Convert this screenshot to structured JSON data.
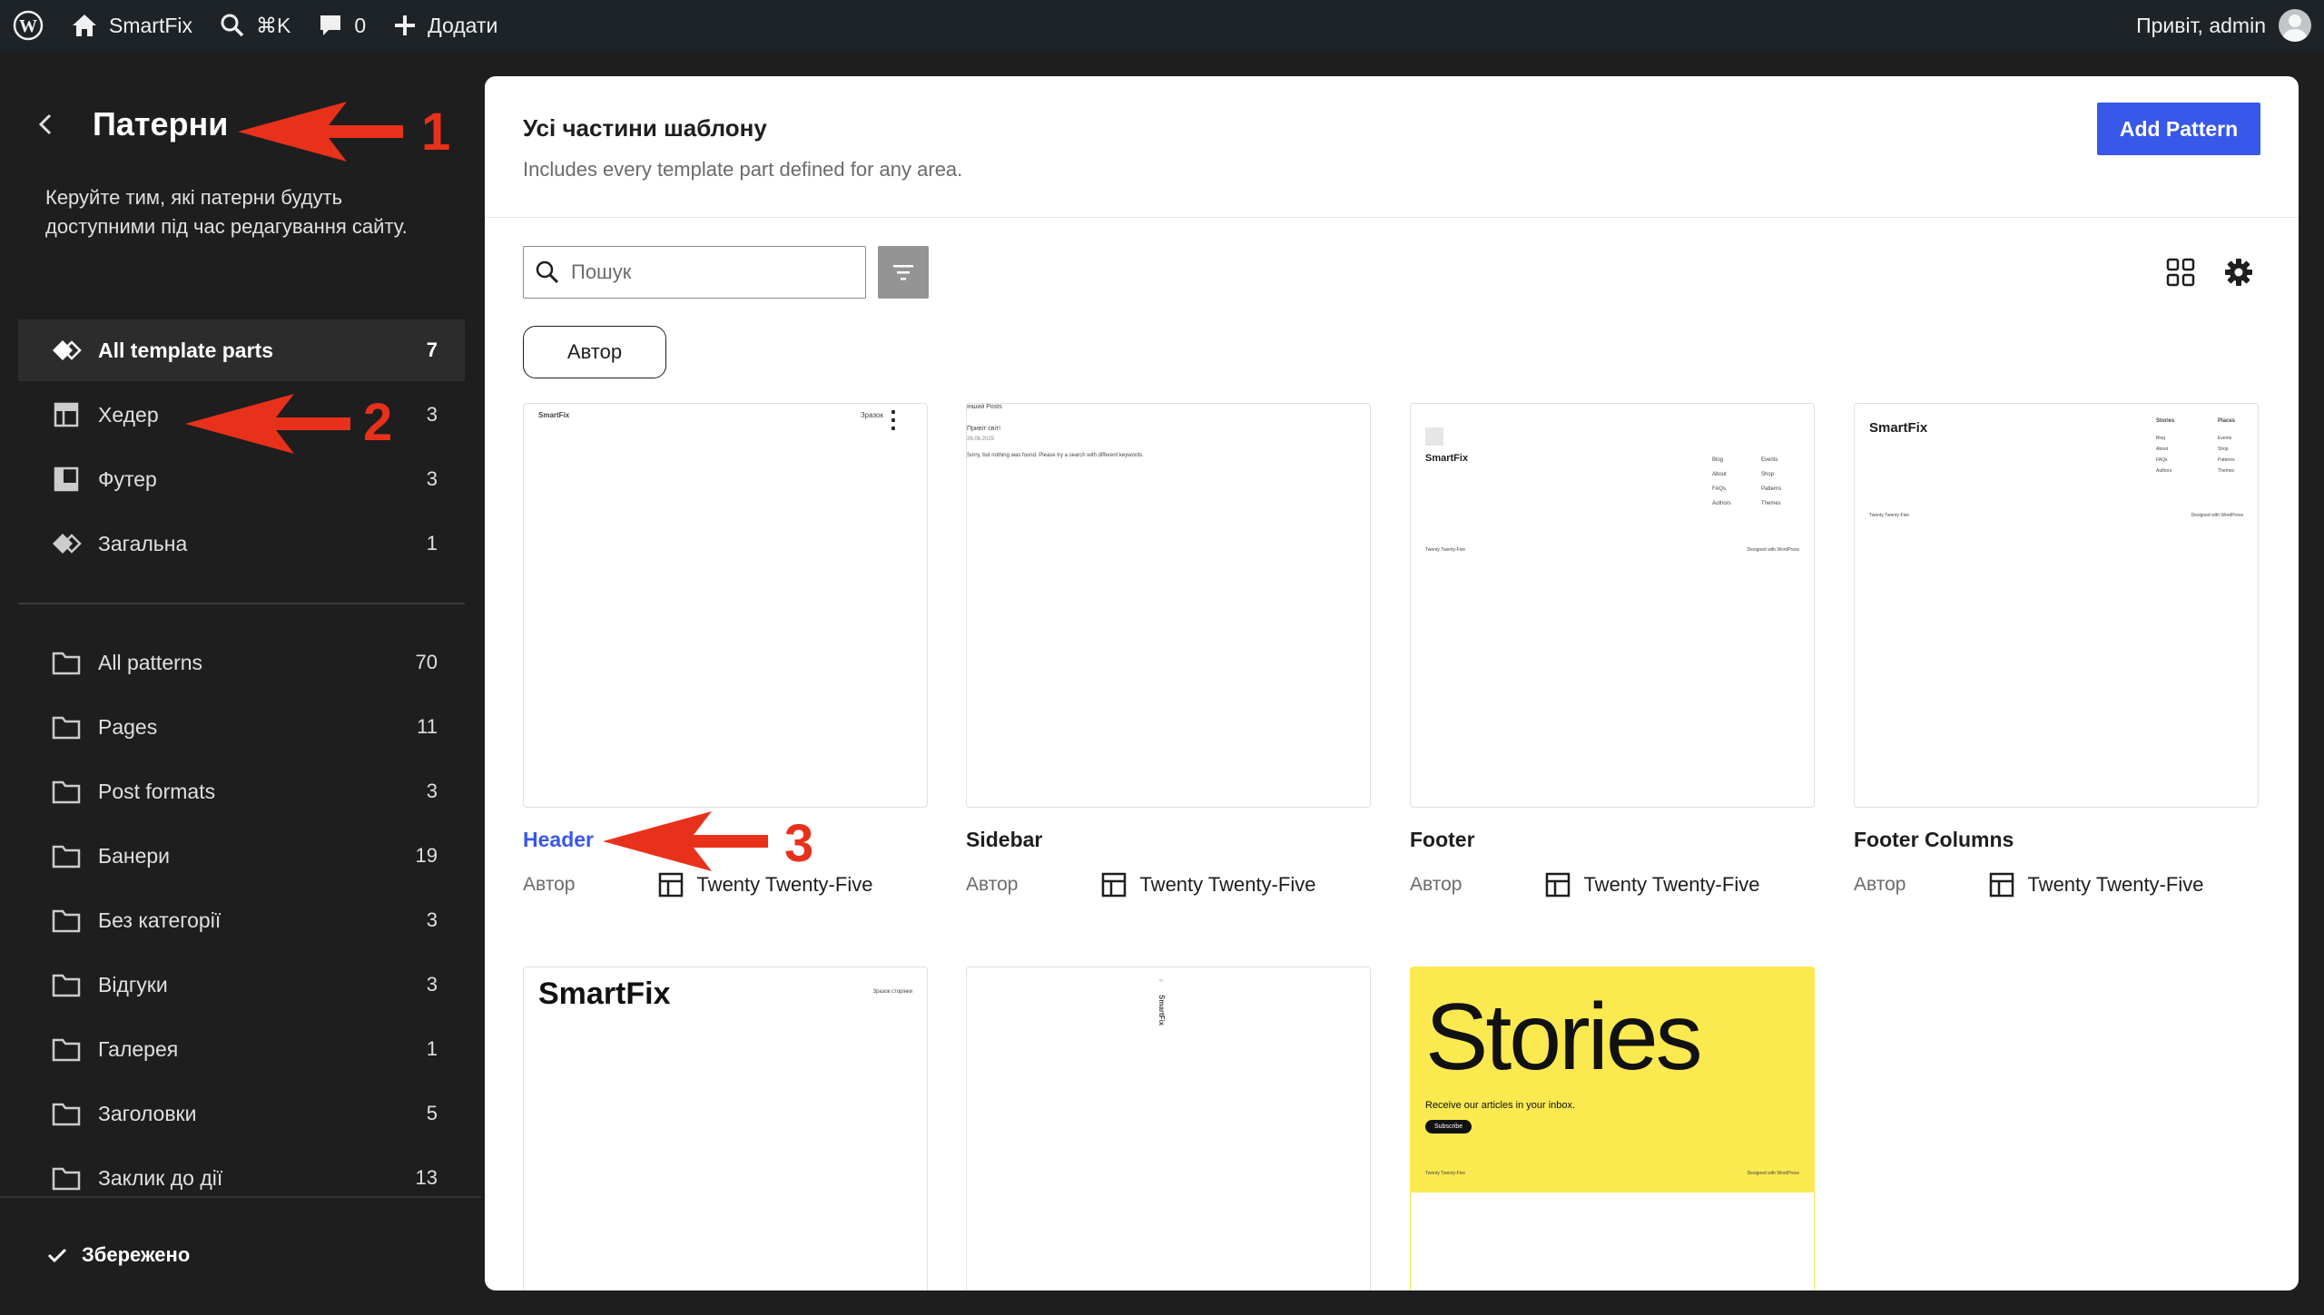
{
  "adminbar": {
    "site_name": "SmartFix",
    "search_shortcut": "⌘K",
    "comments_count": "0",
    "new_label": "Додати",
    "greeting": "Привіт, admin"
  },
  "sidebar": {
    "title": "Патерни",
    "description": "Керуйте тим, які патерни будуть доступними під час редагування сайту.",
    "template_items": [
      {
        "label": "All template parts",
        "count": "7"
      },
      {
        "label": "Хедер",
        "count": "3"
      },
      {
        "label": "Футер",
        "count": "3"
      },
      {
        "label": "Загальна",
        "count": "1"
      }
    ],
    "pattern_items": [
      {
        "label": "All patterns",
        "count": "70"
      },
      {
        "label": "Pages",
        "count": "11"
      },
      {
        "label": "Post formats",
        "count": "3"
      },
      {
        "label": "Банери",
        "count": "19"
      },
      {
        "label": "Без категорії",
        "count": "3"
      },
      {
        "label": "Відгуки",
        "count": "3"
      },
      {
        "label": "Галерея",
        "count": "1"
      },
      {
        "label": "Заголовки",
        "count": "5"
      },
      {
        "label": "Заклик до дії",
        "count": "13"
      }
    ],
    "saved_label": "Збережено"
  },
  "main": {
    "title": "Усі частини шаблону",
    "subtitle": "Includes every template part defined for any area.",
    "add_button": "Add Pattern",
    "search_placeholder": "Пошук",
    "author_filter": "Автор",
    "cards": [
      {
        "title": "Header",
        "meta_label": "Автор",
        "theme": "Twenty Twenty-Five"
      },
      {
        "title": "Sidebar",
        "meta_label": "Автор",
        "theme": "Twenty Twenty-Five"
      },
      {
        "title": "Footer",
        "meta_label": "Автор",
        "theme": "Twenty Twenty-Five"
      },
      {
        "title": "Footer Columns",
        "meta_label": "Автор",
        "theme": "Twenty Twenty-Five"
      }
    ],
    "previews": {
      "header_brand": "SmartFix",
      "header_nav": "Зразок",
      "sidebar_heading": "Інший Posts",
      "sidebar_line1": "Привіт світ!",
      "sidebar_line2": "26.06.2025",
      "sidebar_line3": "Sorry, but nothing was found. Please try a search with different keywords.",
      "footer_brand": "SmartFix",
      "footer_links": [
        "Blog",
        "About",
        "FAQs",
        "Authors"
      ],
      "footer_links2": [
        "Events",
        "Shop",
        "Patterns",
        "Themes"
      ],
      "footer_left": "Twenty Twenty-Five",
      "footer_right": "Designed with WordPress",
      "fc_brand": "SmartFix",
      "fc_col1_title": "Stories",
      "fc_col2_title": "Places",
      "big_header_brand": "SmartFix",
      "big_header_nav": "Зразок сторінки",
      "vertical_brand": "SmartFix",
      "stories_title": "Stories",
      "stories_text": "Receive our articles in your inbox.",
      "stories_button": "Subscribe"
    }
  },
  "annotations": [
    "1",
    "2",
    "3"
  ],
  "colors": {
    "accent": "#3858e9",
    "annotation": "#e8311b",
    "stories_bg": "#fbe950"
  }
}
